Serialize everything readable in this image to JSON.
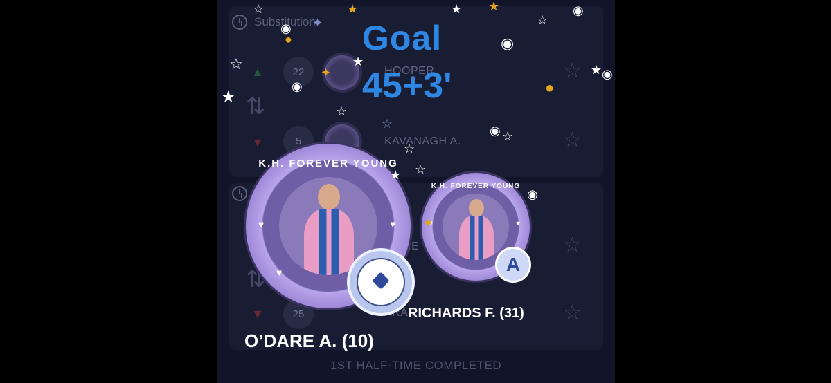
{
  "substitution_section": {
    "label": "Substitution",
    "players_in": {
      "number": "22",
      "name": "HOOPER"
    },
    "players_out": {
      "number": "5",
      "name": "KAVANAGH A."
    }
  },
  "second_section": {
    "row1": {
      "number": "",
      "name": "...NNE"
    },
    "row2": {
      "number": "25",
      "name": "ARA..."
    }
  },
  "goal_overlay": {
    "title": "Goal",
    "minute": "45+3'",
    "scorer": {
      "name": "O’DARE A. (10)",
      "crest_text": "K.H. FOREVER YOUNG"
    },
    "assist": {
      "name": "RICHARDS F. (31)",
      "crest_text": "K.H. FOREVER YOUNG",
      "badge_letter": "A"
    }
  },
  "footer": {
    "status": "1ST HALF-TIME COMPLETED"
  },
  "icons": [
    "clock-icon",
    "swap-icon",
    "arrow-up-icon",
    "arrow-down-icon",
    "star-icon",
    "ball-icon"
  ],
  "colors": {
    "goal_accent": "#2f87e4",
    "background": "#12152a",
    "crest_purple": "#9c86d7",
    "jersey_pink": "#e99cc4",
    "jersey_blue": "#2c5eb0"
  }
}
